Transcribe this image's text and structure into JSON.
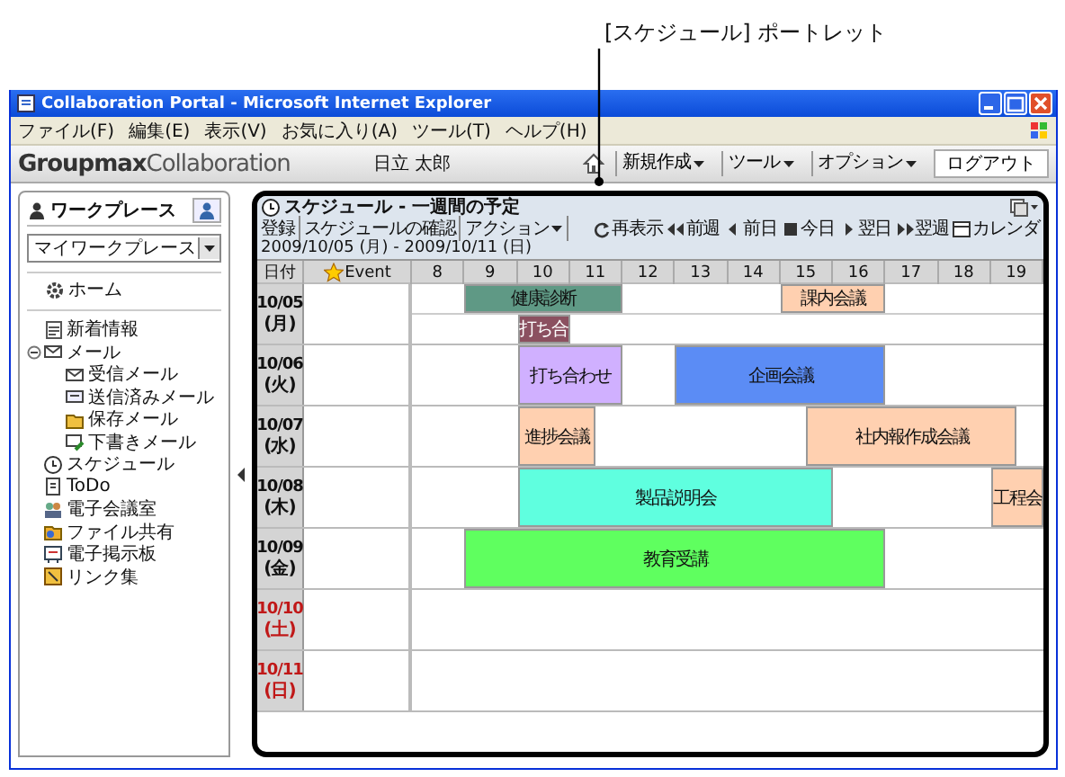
{
  "callout": {
    "label": "[スケジュール] ポートレット"
  },
  "window": {
    "title": "Collaboration Portal - Microsoft Internet Explorer"
  },
  "menu_bar": [
    "ファイル(F)",
    "編集(E)",
    "表示(V)",
    "お気に入り(A)",
    "ツール(T)",
    "ヘルプ(H)"
  ],
  "portal_header": {
    "logo_bold": "Groupmax",
    "logo_light": "Collaboration",
    "user": "日立 太郎",
    "menus": [
      "新規作成",
      "ツール",
      "オプション"
    ],
    "logout": "ログアウト"
  },
  "sidebar": {
    "tab": "ワークプレース",
    "workplace_select": "マイワークプレース",
    "home": "ホーム",
    "items": [
      {
        "label": "新着情報",
        "kind": "news"
      },
      {
        "label": "メール",
        "kind": "mail",
        "expanded": true,
        "children": [
          {
            "label": "受信メール",
            "kind": "inbox"
          },
          {
            "label": "送信済みメール",
            "kind": "sent"
          },
          {
            "label": "保存メール",
            "kind": "saved"
          },
          {
            "label": "下書きメール",
            "kind": "draft"
          }
        ]
      },
      {
        "label": "スケジュール",
        "kind": "schedule"
      },
      {
        "label": "ToDo",
        "kind": "todo"
      },
      {
        "label": "電子会議室",
        "kind": "meeting"
      },
      {
        "label": "ファイル共有",
        "kind": "files"
      },
      {
        "label": "電子掲示板",
        "kind": "board"
      },
      {
        "label": "リンク集",
        "kind": "links"
      }
    ]
  },
  "portlet": {
    "title": "スケジュール - 一週間の予定",
    "actions": [
      "登録",
      "スケジュールの確認"
    ],
    "action_menu": "アクション",
    "nav": [
      {
        "kind": "refresh",
        "label": "再表示"
      },
      {
        "kind": "prev_week",
        "label": "前週"
      },
      {
        "kind": "prev_day",
        "label": "前日"
      },
      {
        "kind": "today",
        "label": "今日"
      },
      {
        "kind": "next_day",
        "label": "翌日"
      },
      {
        "kind": "next_week",
        "label": "翌週"
      },
      {
        "kind": "calendar",
        "label": "カレンダ"
      }
    ],
    "date_range": "2009/10/05 (月) - 2009/10/11 (日)",
    "columns": {
      "date": "日付",
      "event": "Event",
      "hours": [
        "8",
        "9",
        "10",
        "11",
        "12",
        "13",
        "14",
        "15",
        "16",
        "17",
        "18",
        "19"
      ]
    },
    "days": [
      {
        "date": "10/05",
        "weekday": "(月)",
        "holiday": false,
        "lanes": [
          [
            {
              "title": "健康診断",
              "color": "#5f9985"
            },
            {
              "title": "課内会議",
              "color": "#ffd0b0"
            }
          ],
          [
            {
              "title": "打ち合",
              "color": "#8b5060"
            }
          ]
        ]
      },
      {
        "date": "10/06",
        "weekday": "(火)",
        "holiday": false,
        "lanes": [
          [
            {
              "title": "打ち合わせ",
              "color": "#d0b0ff"
            },
            {
              "title": "企画会議",
              "color": "#5b8cf5"
            }
          ]
        ]
      },
      {
        "date": "10/07",
        "weekday": "(水)",
        "holiday": false,
        "lanes": [
          [
            {
              "title": "進捗会議",
              "color": "#ffd0b0"
            },
            {
              "title": "社内報作成会議",
              "color": "#ffd0b0"
            }
          ]
        ]
      },
      {
        "date": "10/08",
        "weekday": "(木)",
        "holiday": false,
        "lanes": [
          [
            {
              "title": "製品説明会",
              "color": "#5fffdf"
            },
            {
              "title": "工程会",
              "color": "#ffd0b0"
            }
          ]
        ]
      },
      {
        "date": "10/09",
        "weekday": "(金)",
        "holiday": false,
        "lanes": [
          [
            {
              "title": "教育受講",
              "color": "#5fff5f"
            }
          ]
        ]
      },
      {
        "date": "10/10",
        "weekday": "(土)",
        "holiday": true
      },
      {
        "date": "10/11",
        "weekday": "(日)",
        "holiday": true
      }
    ]
  }
}
